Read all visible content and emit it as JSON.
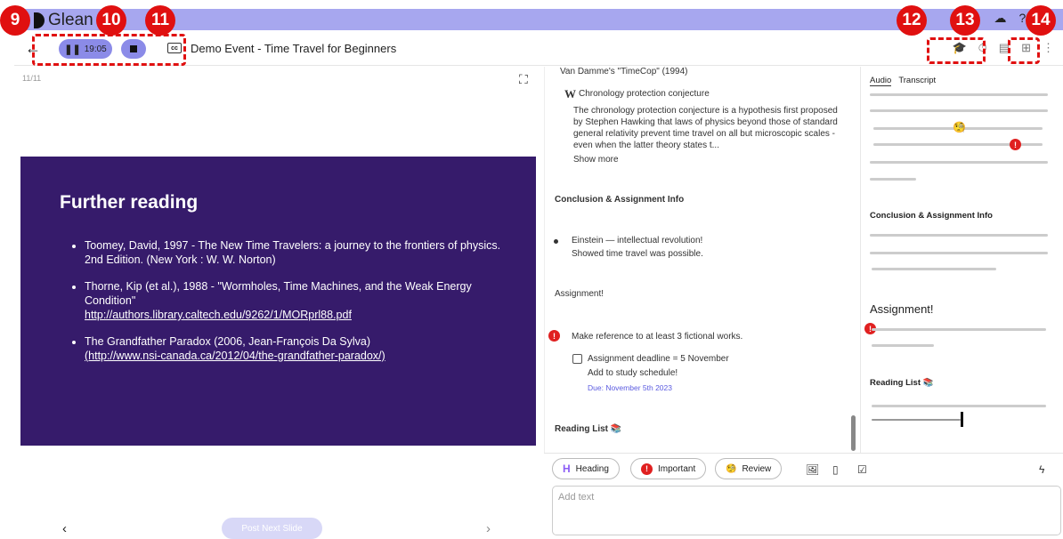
{
  "app": {
    "logo_text": "Glean"
  },
  "annotations": {
    "b9": "9",
    "b10": "10",
    "b11": "11",
    "b12": "12",
    "b13": "13",
    "b14": "14"
  },
  "toolbar": {
    "back_icon": "arrow-left-icon",
    "timer": "19:05",
    "event_title": "Demo Event - Time Travel for Beginners",
    "cc_label": "cc"
  },
  "slide": {
    "counter": "11/11",
    "title": "Further reading",
    "items": [
      {
        "text": "Toomey, David, 1997 - The New Time Travelers: a journey to the frontiers of physics. 2nd Edition. (New York : W. W. Norton)",
        "link": ""
      },
      {
        "text": "Thorne, Kip (et al.), 1988 - \"Wormholes, Time Machines, and the Weak Energy Condition\"",
        "link": "http://authors.library.caltech.edu/9262/1/MORprl88.pdf"
      },
      {
        "text": "The Grandfather Paradox (2006, Jean-François Da Sylva)",
        "link": "(http://www.nsi-canada.ca/2012/04/the-grandfather-paradox/)"
      }
    ],
    "prev": "‹",
    "next": "›",
    "post_button": "Post Next Slide"
  },
  "notes": {
    "vandamme": "Van Damme's \"TimeCop\" (1994)",
    "wiki_letter": "W",
    "wiki_title": "Chronology protection conjecture",
    "wiki_body": "The chronology protection conjecture is a hypothesis first proposed by Stephen Hawking that laws of physics beyond those of standard general relativity prevent time travel on all but microscopic scales - even when the latter theory states t...",
    "show_more": "Show more",
    "conclusion_heading": "Conclusion & Assignment Info",
    "einstein_line1": "Einstein — intellectual revolution!",
    "einstein_line2": "Showed time travel was possible.",
    "assignment_heading": "Assignment!",
    "important_item": "Make reference to at least 3 fictional works.",
    "deadline_line1": "Assignment deadline = 5 November",
    "deadline_line2": "Add to study schedule!",
    "due": "Due: November 5th 2023",
    "reading_list": "Reading List 📚"
  },
  "rightpane": {
    "tab_audio": "Audio",
    "tab_transcript": "Transcript",
    "conclusion_heading": "Conclusion & Assignment Info",
    "assignment_heading": "Assignment!",
    "reading_list": "Reading List 📚"
  },
  "editor": {
    "heading_chip": "Heading",
    "heading_letter": "H",
    "important_chip": "Important",
    "review_chip": "Review",
    "placeholder": "Add text"
  },
  "colors": {
    "topbar": "#a7a7ef",
    "slide_bg": "#361b6b",
    "accent": "#5b5be0",
    "annotation_red": "#e01010"
  }
}
